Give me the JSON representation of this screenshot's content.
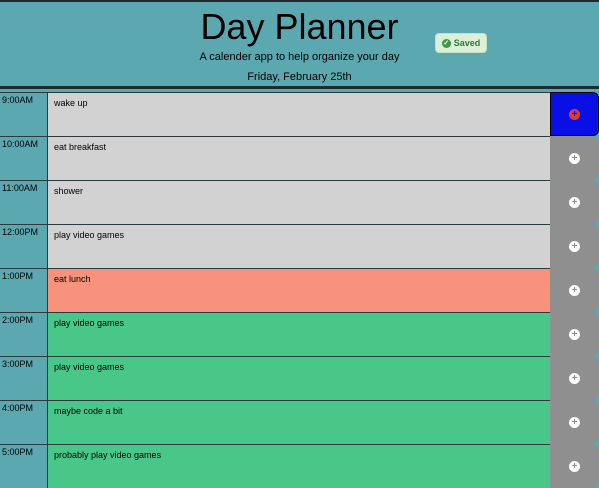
{
  "header": {
    "title": "Day Planner",
    "subtitle": "A calender app to help organize your day",
    "date": "Friday, February 25th",
    "saved_label": "Saved",
    "saved_icon": "check-circle-icon"
  },
  "colors": {
    "past": "#d2d2d2",
    "present": "#f7937d",
    "future": "#49c788",
    "accent": "#0810e6"
  },
  "rows": [
    {
      "hour": "9:00AM",
      "text": "wake up",
      "state": "past"
    },
    {
      "hour": "10:00AM",
      "text": "eat breakfast",
      "state": "past"
    },
    {
      "hour": "11:00AM",
      "text": "shower",
      "state": "past"
    },
    {
      "hour": "12:00PM",
      "text": "play video games",
      "state": "past"
    },
    {
      "hour": "1:00PM",
      "text": "eat lunch",
      "state": "present"
    },
    {
      "hour": "2:00PM",
      "text": "play video games",
      "state": "future"
    },
    {
      "hour": "3:00PM",
      "text": "play video games",
      "state": "future"
    },
    {
      "hour": "4:00PM",
      "text": "maybe code a bit",
      "state": "future"
    },
    {
      "hour": "5:00PM",
      "text": "probably play video games",
      "state": "future"
    }
  ]
}
